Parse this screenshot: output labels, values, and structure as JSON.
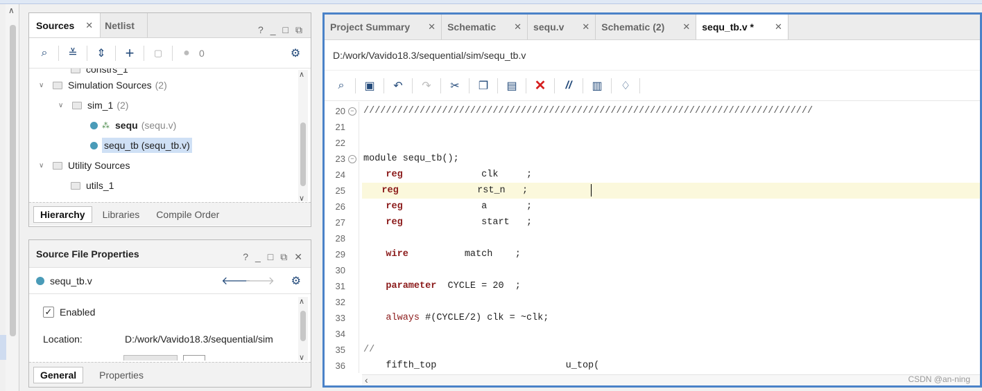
{
  "sources_panel": {
    "tabs": [
      {
        "label": "Sources",
        "active": true
      },
      {
        "label": "Netlist",
        "active": false
      }
    ],
    "window_controls": [
      "?",
      "_",
      "□",
      "⧉"
    ],
    "toolbar": {
      "warnings_count": "0"
    },
    "tree": [
      {
        "label": "constrs_1",
        "count": ""
      },
      {
        "label": "Simulation Sources",
        "count": "(2)"
      },
      {
        "label": "sim_1",
        "count": "(2)"
      },
      {
        "label": "sequ",
        "count": "(sequ.v)"
      },
      {
        "label": "sequ_tb (sequ_tb.v)",
        "count": ""
      },
      {
        "label": "Utility Sources",
        "count": ""
      },
      {
        "label": "utils_1",
        "count": ""
      }
    ],
    "bottom_tabs": [
      {
        "label": "Hierarchy",
        "active": true
      },
      {
        "label": "Libraries",
        "active": false
      },
      {
        "label": "Compile Order",
        "active": false
      }
    ]
  },
  "properties_panel": {
    "title": "Source File Properties",
    "file": "sequ_tb.v",
    "enabled_label": "Enabled",
    "enabled_checked": true,
    "location_label": "Location:",
    "location_value": "D:/work/Vavido18.3/sequential/sim",
    "bottom_tabs": [
      {
        "label": "General",
        "active": true
      },
      {
        "label": "Properties",
        "active": false
      }
    ]
  },
  "editor": {
    "tabs": [
      {
        "label": "Project Summary",
        "active": false
      },
      {
        "label": "Schematic",
        "active": false
      },
      {
        "label": "sequ.v",
        "active": false
      },
      {
        "label": "Schematic (2)",
        "active": false
      },
      {
        "label": "sequ_tb.v *",
        "active": true
      }
    ],
    "path": "D:/work/Vavido18.3/sequential/sim/sequ_tb.v",
    "lines": [
      {
        "num": "20",
        "fold": true,
        "text": "////////////////////////////////////////////////////////////////////////////////"
      },
      {
        "num": "21",
        "fold": false,
        "text": ""
      },
      {
        "num": "22",
        "fold": false,
        "text": ""
      },
      {
        "num": "23",
        "fold": true,
        "text": "module sequ_tb();"
      },
      {
        "num": "24",
        "fold": false,
        "kw": "reg",
        "text": "              clk     ;"
      },
      {
        "num": "25",
        "fold": false,
        "kw": "reg",
        "text": "              rst_n   ;",
        "highlight": true
      },
      {
        "num": "26",
        "fold": false,
        "kw": "reg",
        "text": "              a       ;"
      },
      {
        "num": "27",
        "fold": false,
        "kw": "reg",
        "text": "              start   ;"
      },
      {
        "num": "28",
        "fold": false,
        "text": ""
      },
      {
        "num": "29",
        "fold": false,
        "kw": "wire",
        "text": "          match    ;"
      },
      {
        "num": "30",
        "fold": false,
        "text": ""
      },
      {
        "num": "31",
        "fold": false,
        "kw": "parameter",
        "text": "  CYCLE = 20  ;"
      },
      {
        "num": "32",
        "fold": false,
        "text": ""
      },
      {
        "num": "33",
        "fold": false,
        "kw2": "always",
        "text": " #(CYCLE/2) clk = ~clk;"
      },
      {
        "num": "34",
        "fold": false,
        "text": ""
      },
      {
        "num": "35",
        "fold": false,
        "text": "//"
      },
      {
        "num": "36",
        "fold": false,
        "text": "    fifth_top                       u_top("
      }
    ],
    "watermark": "CSDN @an-ning"
  }
}
